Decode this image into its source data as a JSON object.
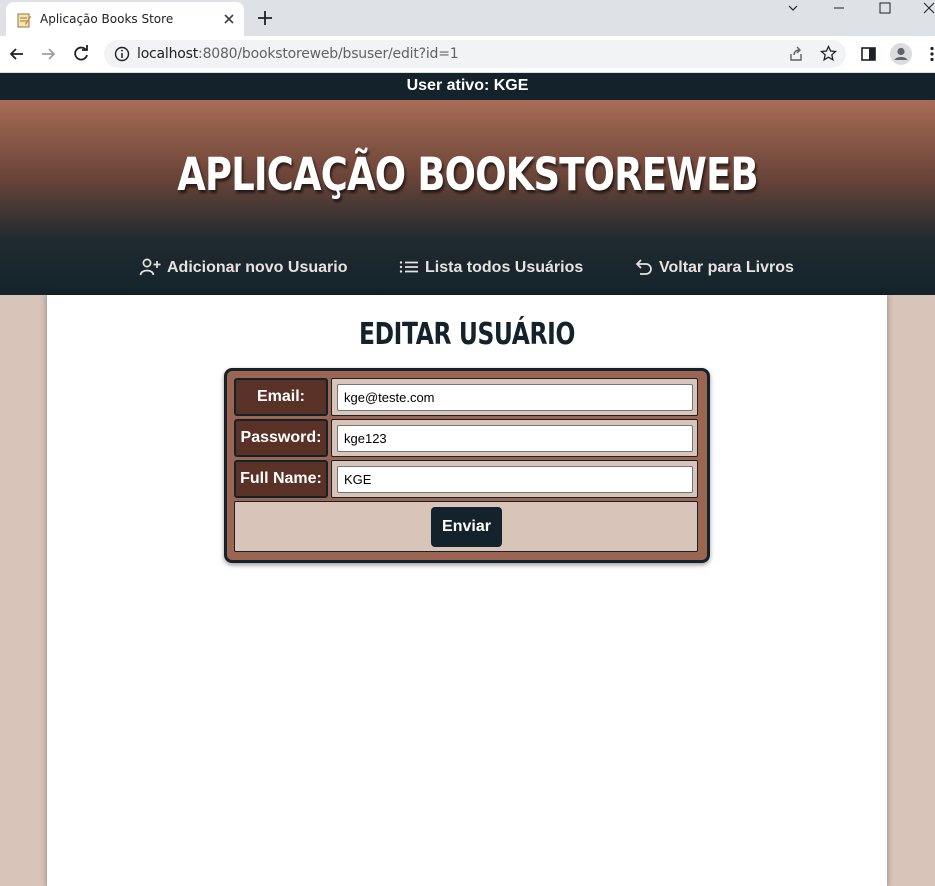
{
  "browser": {
    "tab_title": "Aplicação Books Store",
    "url_host": "localhost",
    "url_path": ":8080/bookstoreweb/bsuser/edit?id=1"
  },
  "page": {
    "active_user": "User ativo: KGE",
    "site_title": "APLICAÇÃO BOOKSTOREWEB",
    "nav": {
      "add_user": "Adicionar novo Usuario",
      "list_users": "Lista todos Usuários",
      "back_books": "Voltar para Livros"
    },
    "heading": "EDITAR USUÁRIO",
    "form": {
      "email_label": "Email:",
      "email_value": "kge@teste.com",
      "password_label": "Password:",
      "password_value": "kge123",
      "fullname_label": "Full Name:",
      "fullname_value": "KGE",
      "submit_label": "Enviar"
    }
  },
  "colors": {
    "dark": "#14232b",
    "brown": "#9c6552",
    "label_brown": "#5a3126",
    "beige": "#d8c4b8"
  },
  "icons": [
    "notepad-favicon-icon",
    "close-icon",
    "plus-icon",
    "back-arrow-icon",
    "forward-arrow-icon",
    "reload-icon",
    "info-icon",
    "share-icon",
    "star-icon",
    "side-panel-icon",
    "profile-icon",
    "menu-dots-icon",
    "add-user-icon",
    "list-icon",
    "undo-arrow-icon"
  ]
}
